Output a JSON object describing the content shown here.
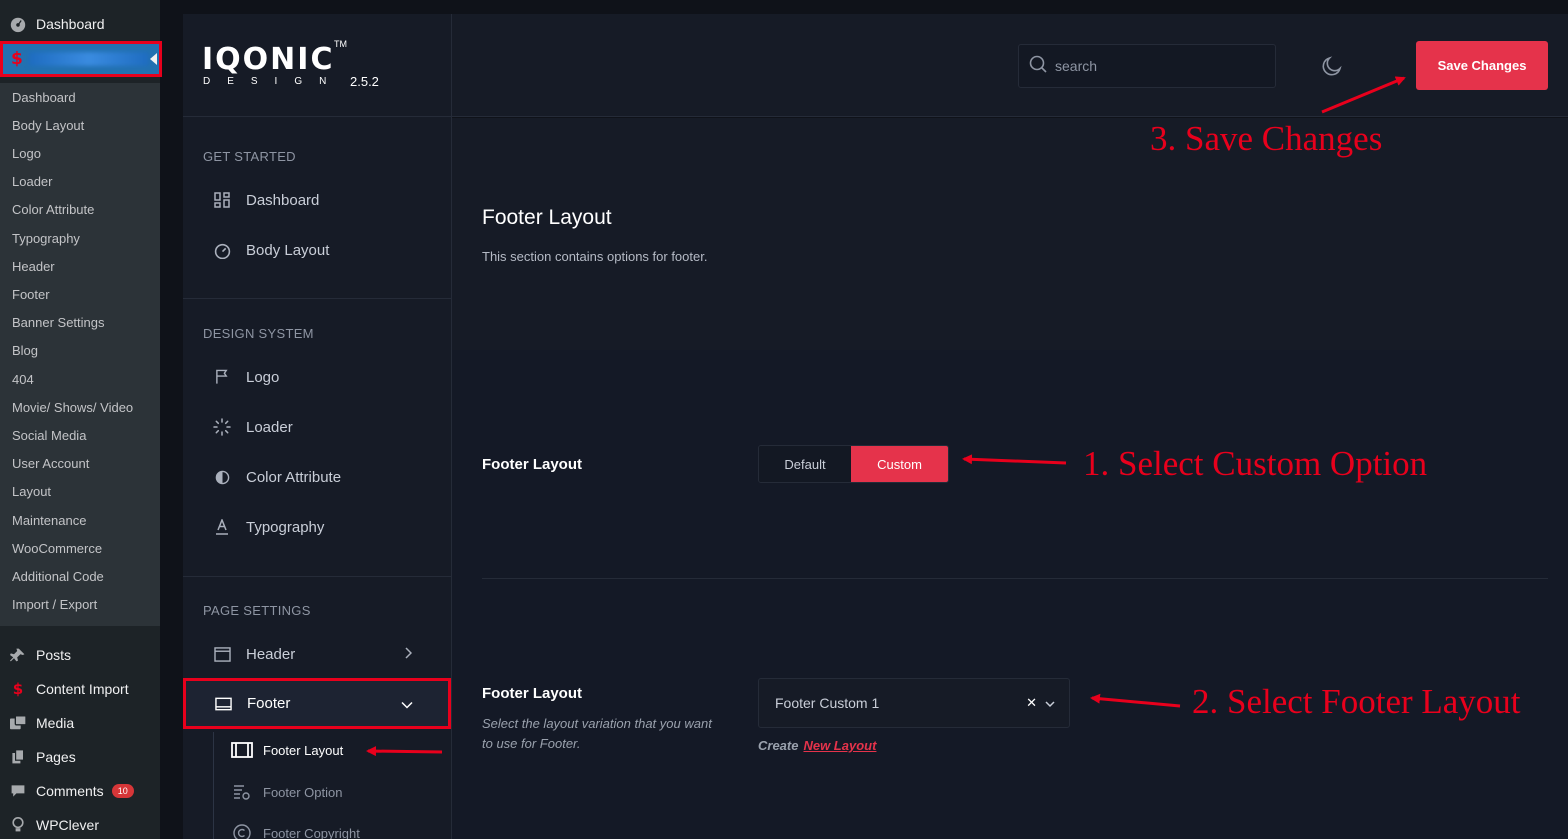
{
  "wp_sidebar": {
    "dashboard": "Dashboard",
    "submenu": [
      "Dashboard",
      "Body Layout",
      "Logo",
      "Loader",
      "Color Attribute",
      "Typography",
      "Header",
      "Footer",
      "Banner Settings",
      "Blog",
      "404",
      "Movie/ Shows/ Video",
      "Social Media",
      "User Account",
      "Layout",
      "Maintenance",
      "WooCommerce",
      "Additional Code",
      "Import / Export"
    ],
    "bottom": {
      "posts": "Posts",
      "content_import": "Content Import",
      "media": "Media",
      "pages": "Pages",
      "comments": "Comments",
      "comments_count": "10",
      "wpclever": "WPClever"
    }
  },
  "logo": {
    "name": "IQONIC",
    "tm": "TM",
    "sub": "DESIGN",
    "version": "2.5.2"
  },
  "nav": {
    "sections": {
      "get_started": "GET STARTED",
      "design_system": "DESIGN SYSTEM",
      "page_settings": "PAGE SETTINGS"
    },
    "dashboard": "Dashboard",
    "body_layout": "Body Layout",
    "logo": "Logo",
    "loader": "Loader",
    "color_attribute": "Color Attribute",
    "typography": "Typography",
    "header": "Header",
    "footer": "Footer",
    "footer_sub": {
      "layout": "Footer Layout",
      "option": "Footer Option",
      "copyright": "Footer Copyright"
    }
  },
  "topbar": {
    "search_placeholder": "search",
    "save_label": "Save Changes"
  },
  "main": {
    "title": "Footer Layout",
    "description": "This section contains options for footer.",
    "field1": {
      "label": "Footer Layout",
      "options": [
        "Default",
        "Custom"
      ],
      "selected": "Custom"
    },
    "field2": {
      "label": "Footer Layout",
      "help": "Select the layout variation that you want to use for Footer.",
      "value": "Footer Custom 1",
      "create_label": "Create",
      "create_link": "New Layout"
    }
  },
  "annotations": {
    "step1": "1. Select Custom Option",
    "step2": "2. Select Footer Layout",
    "step3": "3. Save Changes"
  },
  "colors": {
    "accent": "#e5334b",
    "annotation": "#e8001c",
    "wp_sidebar": "#1d2327",
    "panel": "#161b26"
  }
}
